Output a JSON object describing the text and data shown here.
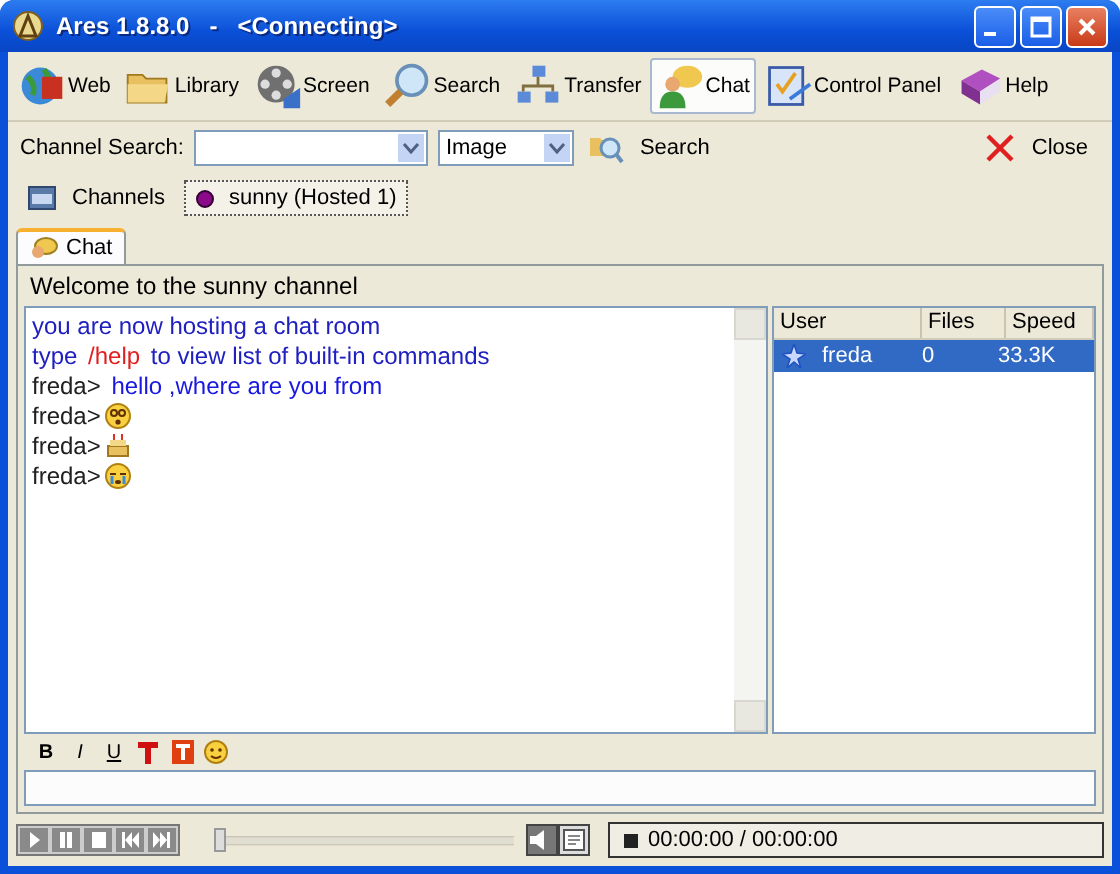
{
  "window": {
    "title": "Ares 1.8.8.0   -   <Connecting>"
  },
  "toolbar": [
    {
      "label": "Web",
      "selected": false
    },
    {
      "label": "Library",
      "selected": false
    },
    {
      "label": "Screen",
      "selected": false
    },
    {
      "label": "Search",
      "selected": false
    },
    {
      "label": "Transfer",
      "selected": false
    },
    {
      "label": "Chat",
      "selected": true
    },
    {
      "label": "Control Panel",
      "selected": false
    },
    {
      "label": "Help",
      "selected": false
    }
  ],
  "channel_search": {
    "label": "Channel Search:",
    "type": "Image",
    "search_button": "Search",
    "close_button": "Close"
  },
  "tabs": [
    {
      "label": "Channels",
      "kind": "list",
      "selected": false
    },
    {
      "label": "sunny (Hosted 1)",
      "kind": "room",
      "selected": true
    }
  ],
  "subtabs": [
    {
      "label": "Chat",
      "selected": true
    }
  ],
  "welcome": "Welcome to the sunny channel",
  "chat_lines": [
    {
      "kind": "text",
      "parts": [
        {
          "kind": "system",
          "text": "you are now hosting a chat room"
        }
      ]
    },
    {
      "kind": "text",
      "parts": [
        {
          "kind": "system",
          "text": "type "
        },
        {
          "kind": "command",
          "text": "/help"
        },
        {
          "kind": "system",
          "text": " to view list of built-in commands"
        }
      ]
    },
    {
      "kind": "text",
      "parts": [
        {
          "kind": "nick",
          "text": "freda> "
        },
        {
          "kind": "message",
          "text": "hello ,where are you from"
        }
      ]
    },
    {
      "kind": "emoticon",
      "nick": "freda>"
    },
    {
      "kind": "emoticon",
      "nick": "freda>"
    },
    {
      "kind": "emoticon",
      "nick": "freda>"
    }
  ],
  "users": {
    "columns": [
      "User",
      "Files",
      "Speed"
    ],
    "rows": [
      {
        "cells": [
          "freda",
          "0",
          "33.3K"
        ],
        "selected": true
      }
    ]
  },
  "format_toolbar": [
    {
      "label": "B",
      "kind": "bold"
    },
    {
      "label": "I",
      "kind": "italic"
    },
    {
      "label": "U",
      "kind": "underline"
    },
    {
      "kind": "text-color"
    },
    {
      "kind": "back-color"
    },
    {
      "kind": "emoticon"
    }
  ],
  "player": {
    "time": "00:00:00 / 00:00:00",
    "level": 0.0
  }
}
